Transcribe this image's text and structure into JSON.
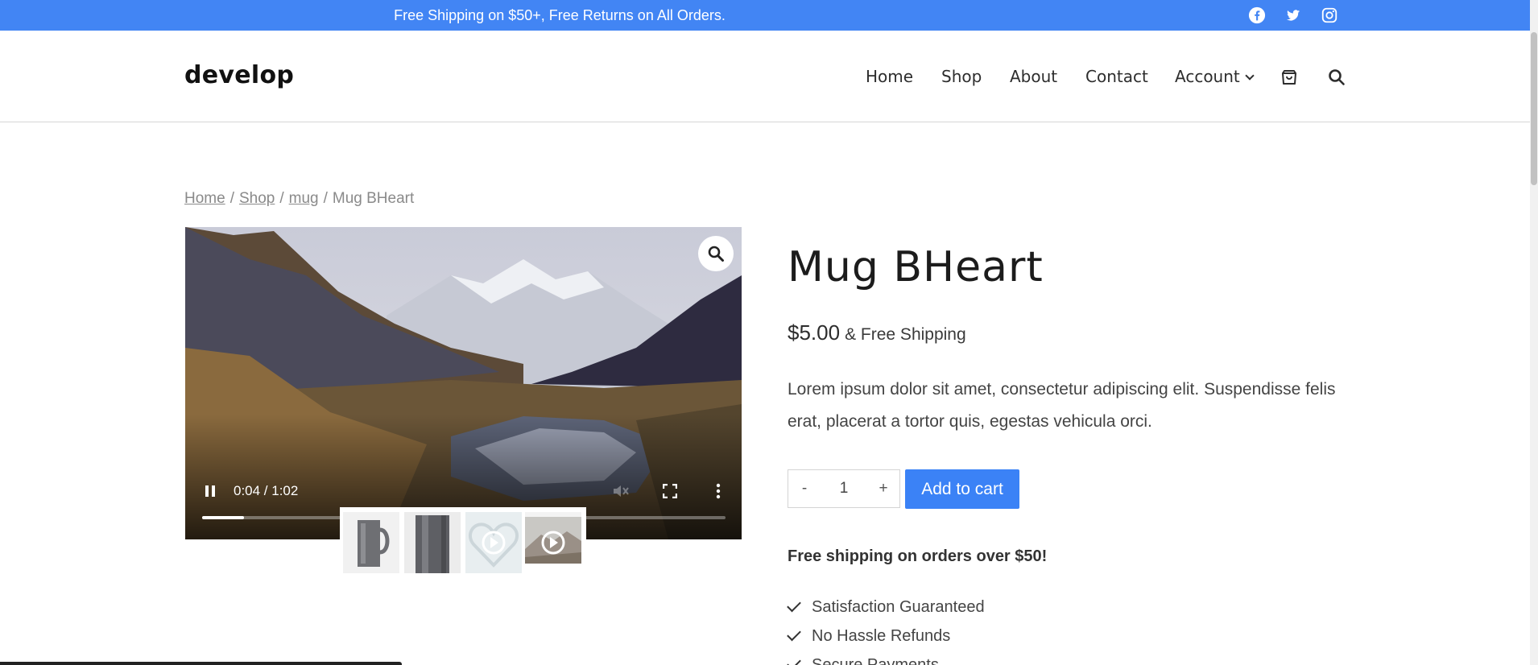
{
  "topbar": {
    "promo": "Free Shipping on $50+, Free Returns on All Orders.",
    "social": [
      "facebook-icon",
      "twitter-icon",
      "instagram-icon"
    ],
    "bg": "#4285f4"
  },
  "header": {
    "logo": "develop",
    "nav": [
      {
        "label": "Home"
      },
      {
        "label": "Shop"
      },
      {
        "label": "About"
      },
      {
        "label": "Contact"
      },
      {
        "label": "Account"
      }
    ],
    "icons": [
      "cart-icon",
      "search-icon"
    ]
  },
  "breadcrumb": {
    "items": [
      "Home",
      "Shop",
      "mug"
    ],
    "separator": "/",
    "current": "Mug BHeart"
  },
  "video": {
    "time": "0:04 / 1:02",
    "progress": 0.08,
    "controls": [
      "pause-icon",
      "mute-icon",
      "fullscreen-icon",
      "more-options-icon"
    ]
  },
  "gallery": {
    "thumbnails": [
      "mug-front",
      "mug-side",
      "heart-video",
      "mountain-video"
    ]
  },
  "product": {
    "title": "Mug BHeart",
    "price": "$5.00",
    "shipping": "& Free Shipping",
    "description": "Lorem ipsum dolor sit amet, consectetur adipiscing elit. Suspendisse felis erat, placerat a tortor quis, egestas vehicula orci.",
    "qty_minus": "-",
    "qty_value": "1",
    "qty_plus": "+",
    "add_to_cart": "Add to cart",
    "shipping_note": "Free shipping on orders over $50!",
    "features": [
      "Satisfaction Guaranteed",
      "No Hassle Refunds",
      "Secure Payments"
    ],
    "accent": "#3b82f6"
  }
}
